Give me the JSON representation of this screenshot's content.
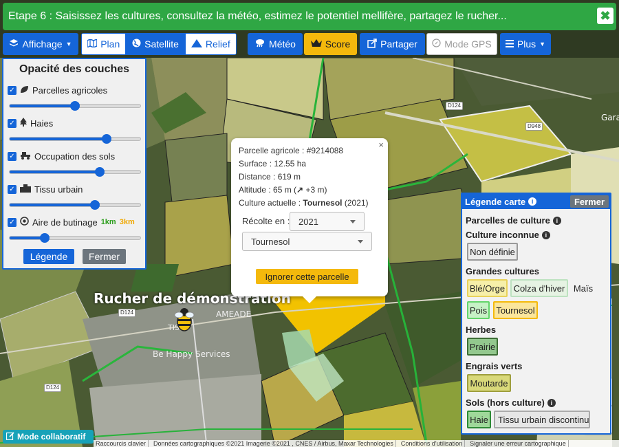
{
  "banner": {
    "text": "Etape 6 : Saisissez les cultures, consultez la météo, estimez le potentiel mellifère, partagez le rucher...",
    "close": "✖"
  },
  "toolbar": {
    "affichage": "Affichage",
    "plan": "Plan",
    "satellite": "Satellite",
    "relief": "Relief",
    "meteo": "Météo",
    "score": "Score",
    "partager": "Partager",
    "gps": "Mode GPS",
    "plus": "Plus"
  },
  "layers": {
    "title": "Opacité des couches",
    "items": [
      {
        "label": "Parcelles agricoles",
        "icon": "leaf-icon",
        "checked": true,
        "value": 0.5
      },
      {
        "label": "Haies",
        "icon": "tree-icon",
        "checked": true,
        "value": 0.74
      },
      {
        "label": "Occupation des sols",
        "icon": "tractor-icon",
        "checked": true,
        "value": 0.69
      },
      {
        "label": "Tissu urbain",
        "icon": "city-icon",
        "checked": true,
        "value": 0.65
      },
      {
        "label": "Aire de butinage",
        "icon": "target-icon",
        "checked": true,
        "value": 0.27,
        "km1": "1km",
        "km2": "3km"
      }
    ],
    "legend_btn": "Légende",
    "close_btn": "Fermer"
  },
  "popup": {
    "parcelle": "Parcelle agricole : #9214088",
    "surface": "Surface : 12.55 ha",
    "distance": "Distance : 619 m",
    "altitude_prefix": "Altitude : 65 m (",
    "altitude_suffix": " +3 m)",
    "culture_prefix": "Culture actuelle : ",
    "culture_value": "Tournesol",
    "culture_year": " (2021)",
    "recolte_label": "Récolte en :",
    "year_value": "2021",
    "crop_value": "Tournesol",
    "ignore_btn": "Ignorer cette parcelle",
    "close": "×"
  },
  "legend": {
    "title": "Légende carte",
    "close": "Fermer",
    "parcelles": "Parcelles de culture",
    "inconnue": "Culture inconnue",
    "non_definie": "Non définie",
    "grandes": "Grandes cultures",
    "ble": "Blé/Orge",
    "colza": "Colza d'hiver",
    "mais": "Maïs",
    "pois": "Pois",
    "tournesol": "Tournesol",
    "herbes": "Herbes",
    "prairie": "Prairie",
    "engrais": "Engrais verts",
    "moutarde": "Moutarde",
    "sols": "Sols (hors culture)",
    "haie": "Haie",
    "tissu": "Tissu urbain discontinu"
  },
  "map": {
    "rucher_label": "Rucher de démonstration",
    "ameade": "AMEADE",
    "tissu": "TISSU",
    "bhs": "Be Happy Services",
    "gara": "Gara",
    "roads": [
      "D124",
      "D948",
      "D124",
      "D124"
    ]
  },
  "collab": "Mode collaboratif",
  "attribution": [
    "Raccourcis clavier",
    "Données cartographiques ©2021 Imagerie ©2021 , CNES / Airbus, Maxar Technologies",
    "Conditions d'utilisation",
    "Signaler une erreur cartographique"
  ],
  "colors": {
    "primary": "#1565d8",
    "success": "#2fa744",
    "warning": "#f4b90c",
    "info": "#17a2b8"
  }
}
